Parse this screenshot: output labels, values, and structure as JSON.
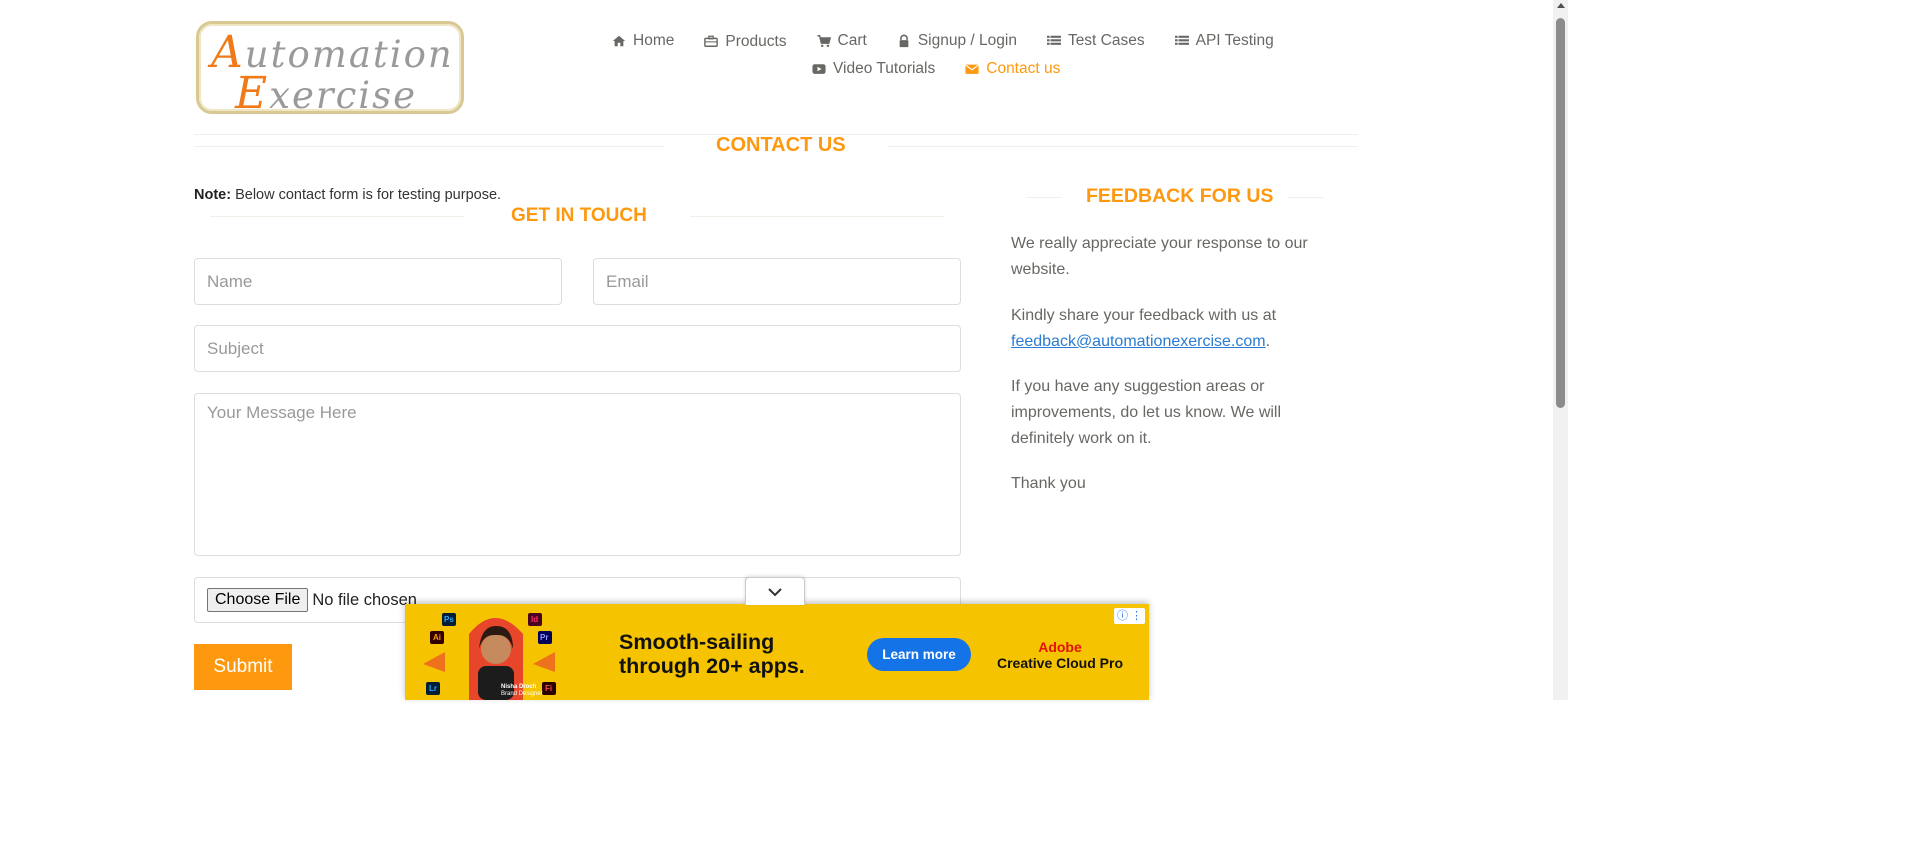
{
  "logo": {
    "line1_cap": "A",
    "line1_rest": "utomation",
    "line2_cap": "E",
    "line2_rest": "xercise"
  },
  "nav": {
    "items": [
      {
        "label": "Home",
        "icon": "home-icon"
      },
      {
        "label": "Products",
        "icon": "briefcase-icon"
      },
      {
        "label": "Cart",
        "icon": "cart-icon"
      },
      {
        "label": "Signup / Login",
        "icon": "lock-icon"
      },
      {
        "label": "Test Cases",
        "icon": "list-icon"
      },
      {
        "label": "API Testing",
        "icon": "list-icon"
      },
      {
        "label": "Video Tutorials",
        "icon": "youtube-icon"
      },
      {
        "label": "Contact us",
        "icon": "envelope-icon",
        "active": true
      }
    ],
    "active_color": "#fe980f"
  },
  "page": {
    "title": "Contact Us"
  },
  "form": {
    "note_bold": "Note:",
    "note_text": " Below contact form is for testing purpose.",
    "title": "Get In Touch",
    "name_placeholder": "Name",
    "email_placeholder": "Email",
    "subject_placeholder": "Subject",
    "message_placeholder": "Your Message Here",
    "choose_file_label": "Choose File",
    "file_status": "No file chosen",
    "submit_label": "Submit"
  },
  "feedback": {
    "title": "Feedback For Us",
    "p1": "We really appreciate your response to our website.",
    "p2_prefix": "Kindly share your feedback with us at ",
    "p2_email": "feedback@automationexercise.com",
    "p2_suffix": ".",
    "p3": "If you have any suggestion areas or improvements, do let us know. We will definitely work on it.",
    "p4": "Thank you"
  },
  "ad": {
    "headline": "Smooth-sailing through 20+ apps.",
    "cta": "Learn more",
    "brand_line1": "Adobe",
    "brand_line2": "Creative Cloud Pro",
    "persona_name": "Nisha Droch",
    "persona_role": "Brand Designer",
    "app_badges": [
      "Ps",
      "Id",
      "Ai",
      "Pr",
      "Lr",
      "Fi"
    ],
    "background_color": "#f5c300"
  },
  "colors": {
    "accent": "#fe980f",
    "text": "#696763",
    "link": "#2a7bd1"
  }
}
